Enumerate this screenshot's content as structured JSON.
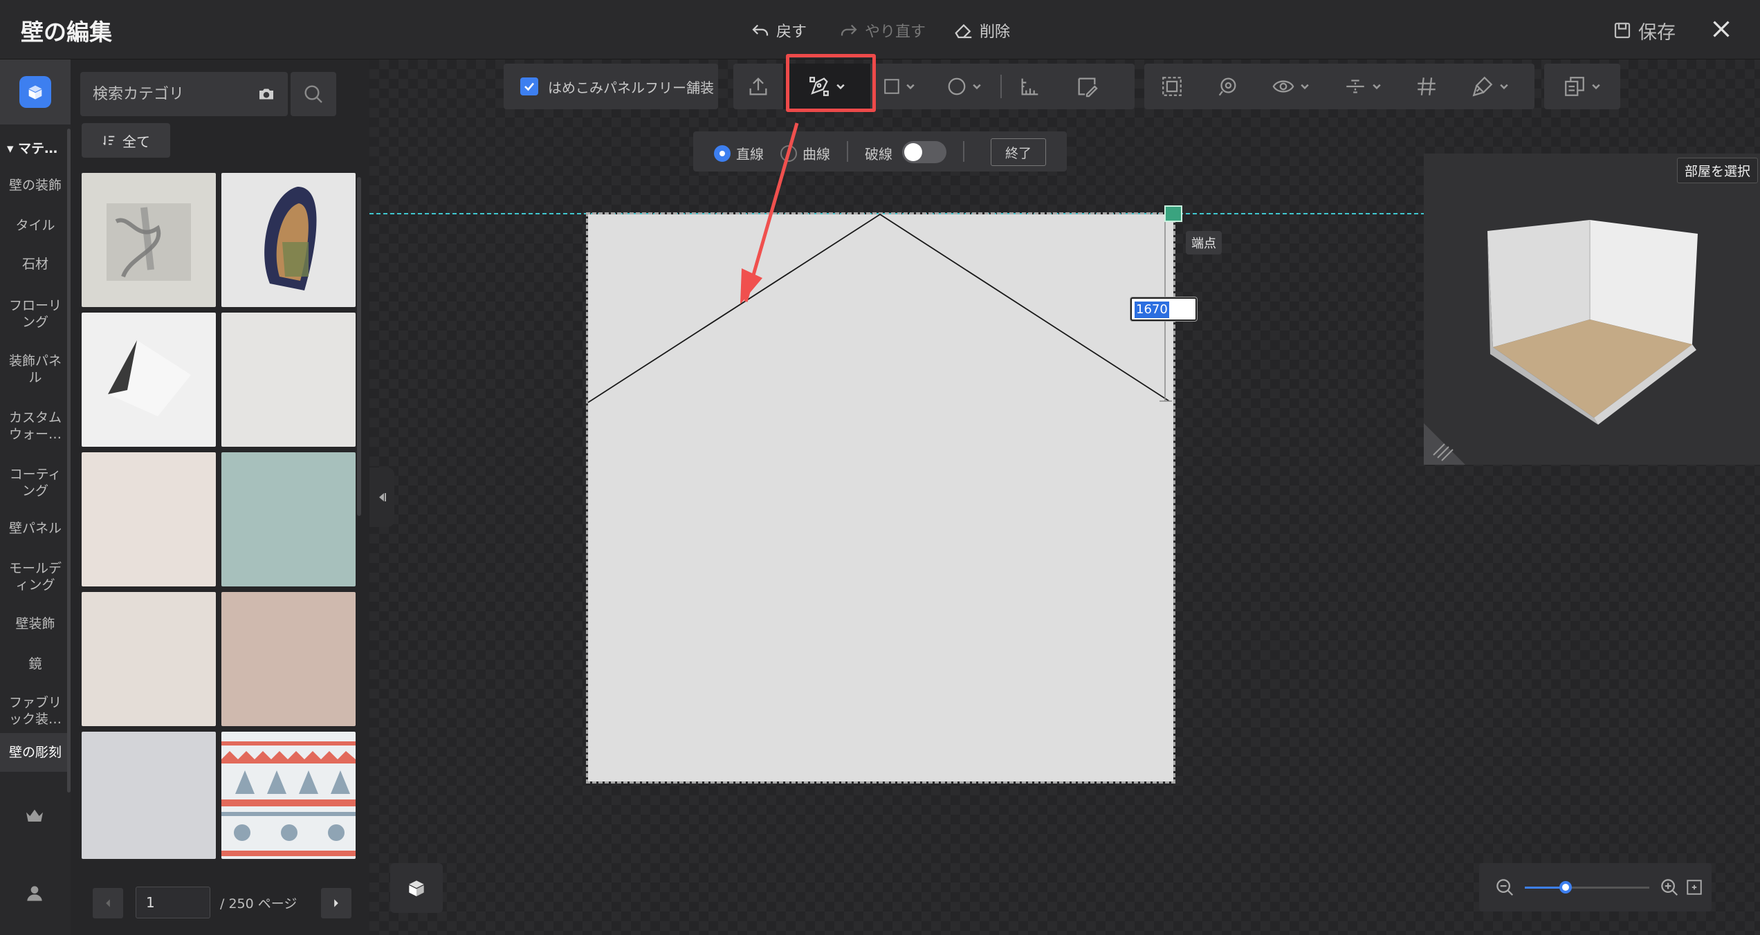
{
  "header": {
    "title": "壁の編集",
    "undo_label": "戻す",
    "redo_label": "やり直す",
    "delete_label": "削除",
    "save_label": "保存"
  },
  "rail": {
    "section_label": "マテ…",
    "items": [
      {
        "label": "壁の装飾"
      },
      {
        "label": "タイル"
      },
      {
        "label": "石材"
      },
      {
        "label": "フローリング"
      },
      {
        "label": "装飾パネル"
      },
      {
        "label": "カスタムウォー…"
      },
      {
        "label": "コーティング"
      },
      {
        "label": "壁パネル"
      },
      {
        "label": "モールディング"
      },
      {
        "label": "壁装飾"
      },
      {
        "label": "鏡"
      },
      {
        "label": "ファブリック装…"
      },
      {
        "label": "壁の彫刻"
      }
    ]
  },
  "panel": {
    "search_placeholder": "検索カテゴリ",
    "all_label": "全て",
    "page_value": "1",
    "page_total": "/ 250 ページ"
  },
  "toolbar": {
    "checkbox_label": "はめこみパネルフリー舗装"
  },
  "drawbar": {
    "straight_label": "直線",
    "curve_label": "曲線",
    "dashed_label": "破線",
    "end_label": "終了"
  },
  "canvas": {
    "vertex_tooltip": "端点",
    "dimension_value": "1670"
  },
  "preview": {
    "select_room_label": "部屋を選択"
  },
  "zoom": {
    "level": 0.33
  },
  "colors": {
    "accent": "#3d7ff0",
    "highlight": "#ee4a4a",
    "guide": "#3fc7cf",
    "handle": "#3aa37f"
  }
}
